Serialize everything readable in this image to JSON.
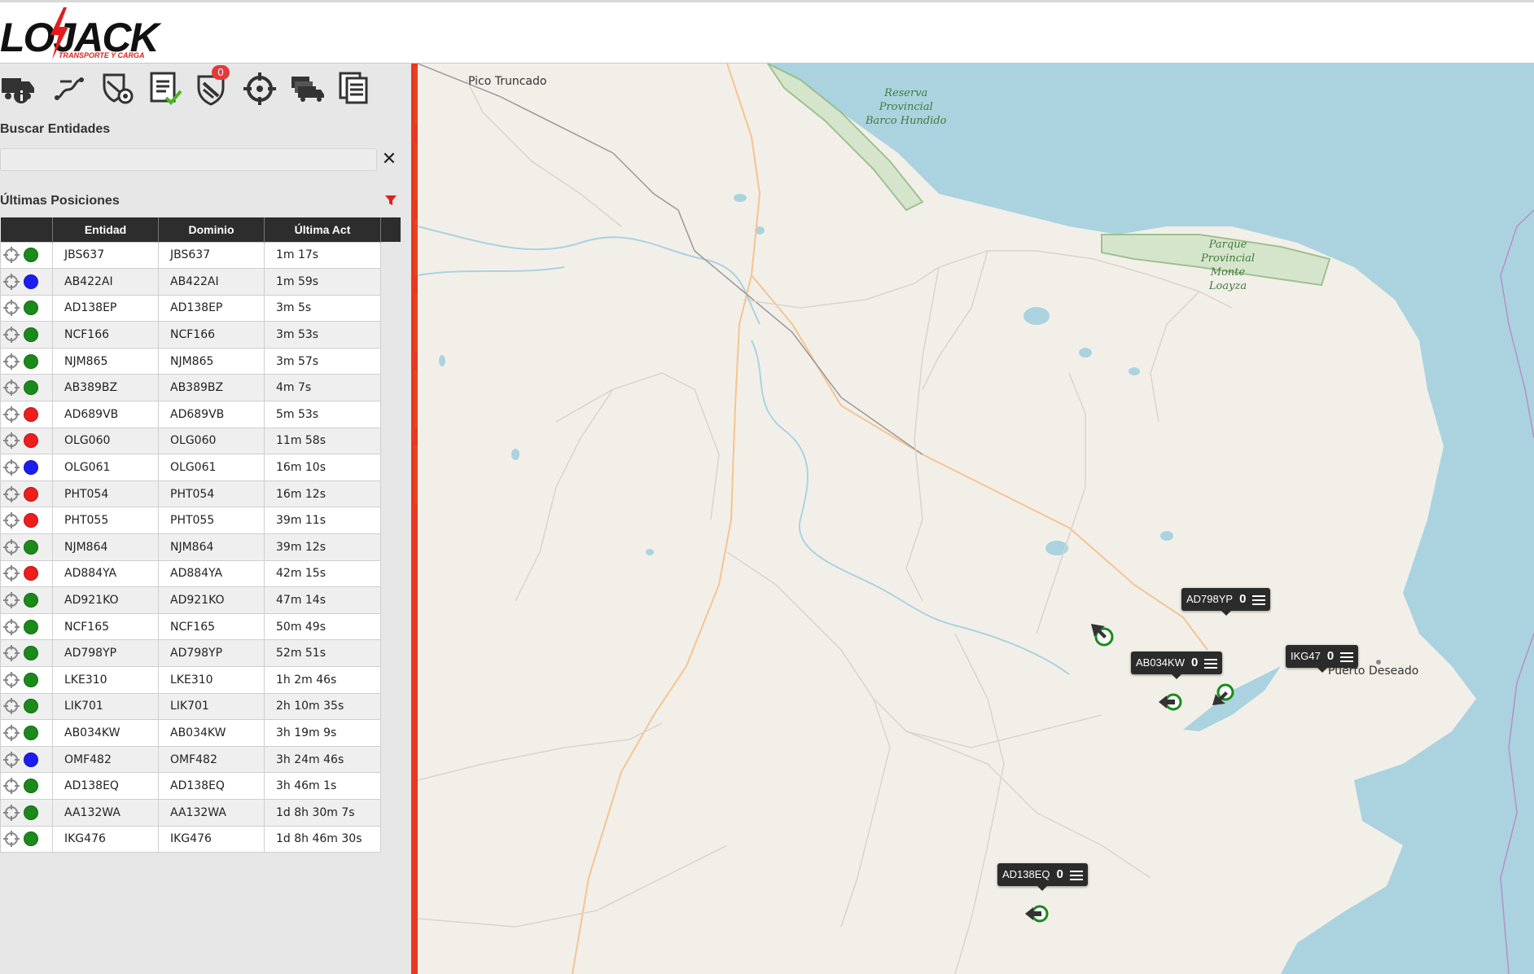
{
  "header": {
    "logo_text": "LOJACK",
    "logo_tagline": "TRANSPORTE Y CARGA"
  },
  "toolbar": {
    "tools": [
      {
        "icon": "truck-info-icon"
      },
      {
        "icon": "route-icon"
      },
      {
        "icon": "shield-gear-icon"
      },
      {
        "icon": "document-check-icon"
      },
      {
        "icon": "shield-alert-icon",
        "badge": "0"
      },
      {
        "icon": "crosshair-icon"
      },
      {
        "icon": "fleet-icon"
      },
      {
        "icon": "documents-icon"
      }
    ]
  },
  "search": {
    "label": "Buscar Entidades",
    "value": "",
    "placeholder": "",
    "clear_label": "✕"
  },
  "positions": {
    "title": "Últimas Posiciones",
    "columns": [
      "",
      "Entidad",
      "Dominio",
      "Última Act"
    ],
    "status_colors": {
      "green": "#1a8a1a",
      "blue": "#1d1df0",
      "red": "#f01d1d"
    },
    "rows": [
      {
        "entity": "JBS637",
        "domain": "JBS637",
        "last": "1m 17s",
        "status": "green"
      },
      {
        "entity": "AB422AI",
        "domain": "AB422AI",
        "last": "1m 59s",
        "status": "blue"
      },
      {
        "entity": "AD138EP",
        "domain": "AD138EP",
        "last": "3m 5s",
        "status": "green"
      },
      {
        "entity": "NCF166",
        "domain": "NCF166",
        "last": "3m 53s",
        "status": "green"
      },
      {
        "entity": "NJM865",
        "domain": "NJM865",
        "last": "3m 57s",
        "status": "green"
      },
      {
        "entity": "AB389BZ",
        "domain": "AB389BZ",
        "last": "4m 7s",
        "status": "green"
      },
      {
        "entity": "AD689VB",
        "domain": "AD689VB",
        "last": "5m 53s",
        "status": "red"
      },
      {
        "entity": "OLG060",
        "domain": "OLG060",
        "last": "11m 58s",
        "status": "red"
      },
      {
        "entity": "OLG061",
        "domain": "OLG061",
        "last": "16m 10s",
        "status": "blue"
      },
      {
        "entity": "PHT054",
        "domain": "PHT054",
        "last": "16m 12s",
        "status": "red"
      },
      {
        "entity": "PHT055",
        "domain": "PHT055",
        "last": "39m 11s",
        "status": "red"
      },
      {
        "entity": "NJM864",
        "domain": "NJM864",
        "last": "39m 12s",
        "status": "green"
      },
      {
        "entity": "AD884YA",
        "domain": "AD884YA",
        "last": "42m 15s",
        "status": "red"
      },
      {
        "entity": "AD921KO",
        "domain": "AD921KO",
        "last": "47m 14s",
        "status": "green"
      },
      {
        "entity": "NCF165",
        "domain": "NCF165",
        "last": "50m 49s",
        "status": "green"
      },
      {
        "entity": "AD798YP",
        "domain": "AD798YP",
        "last": "52m 51s",
        "status": "green"
      },
      {
        "entity": "LKE310",
        "domain": "LKE310",
        "last": "1h 2m 46s",
        "status": "green"
      },
      {
        "entity": "LIK701",
        "domain": "LIK701",
        "last": "2h 10m 35s",
        "status": "green"
      },
      {
        "entity": "AB034KW",
        "domain": "AB034KW",
        "last": "3h 19m 9s",
        "status": "green"
      },
      {
        "entity": "OMF482",
        "domain": "OMF482",
        "last": "3h 24m 46s",
        "status": "blue"
      },
      {
        "entity": "AD138EQ",
        "domain": "AD138EQ",
        "last": "3h 46m 1s",
        "status": "green"
      },
      {
        "entity": "AA132WA",
        "domain": "AA132WA",
        "last": "1d 8h 30m 7s",
        "status": "green"
      },
      {
        "entity": "IKG476",
        "domain": "IKG476",
        "last": "1d 8h 46m 30s",
        "status": "green"
      }
    ]
  },
  "side_tabs": [
    {
      "icon": "list-icon"
    },
    {
      "icon": "shield-icon"
    },
    {
      "icon": "report-icon"
    },
    {
      "icon": "globe-icon"
    },
    {
      "icon": "search-gear-icon"
    },
    {
      "icon": "unlock-icon"
    }
  ],
  "map": {
    "places": {
      "pico_truncado": "Pico Truncado",
      "puerto_deseado": "Puerto Deseado"
    },
    "parks": {
      "barco_hundido": [
        "Reserva",
        "Provincial",
        "Barco Hundido"
      ],
      "monte_loayza": [
        "Parque",
        "Provincial",
        "Monte",
        "Loayza"
      ]
    },
    "vehicles": [
      {
        "id": "AD798YP",
        "count": "0"
      },
      {
        "id": "IKG476",
        "label_visible": "IKG47",
        "count": "0"
      },
      {
        "id": "AB034KW",
        "count": "0"
      },
      {
        "id": "AD138EQ",
        "count": "0"
      }
    ]
  }
}
